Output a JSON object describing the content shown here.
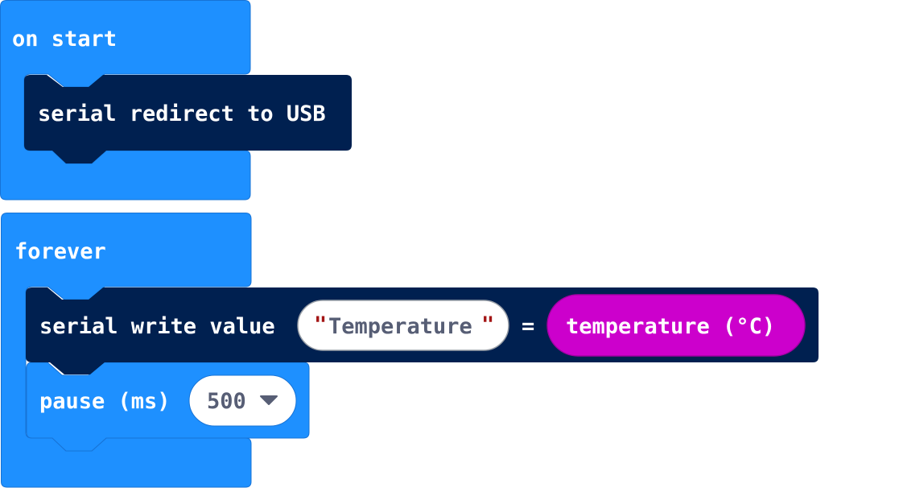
{
  "blocks": {
    "on_start": {
      "label": "on start",
      "color": "#1e90ff",
      "children": {
        "serial_redirect": {
          "label": "serial redirect to USB",
          "color": "#002050"
        }
      }
    },
    "forever": {
      "label": "forever",
      "color": "#1e90ff",
      "children": {
        "serial_write_value": {
          "label": "serial write value",
          "color": "#002050",
          "name_value": "Temperature",
          "quote_open": "\"",
          "quote_close": "\"",
          "equals": "=",
          "value_block": {
            "label": "temperature (°C)",
            "color": "#cc00cc"
          }
        },
        "pause": {
          "label": "pause (ms)",
          "color": "#1e90ff",
          "value": "500",
          "dropdown_icon": "triangle-down-icon"
        }
      }
    }
  }
}
